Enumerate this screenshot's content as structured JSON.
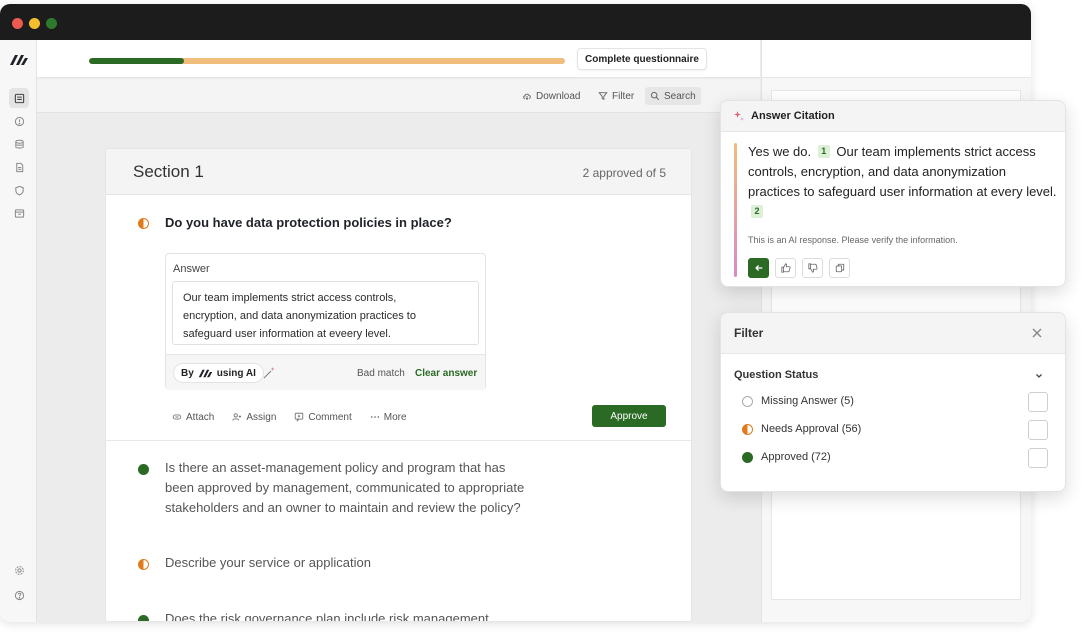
{
  "progress": {
    "approved_fraction": 0.2
  },
  "topbar": {
    "complete_label": "Complete questionnaire"
  },
  "toolbar": {
    "download_label": "Download",
    "filter_label": "Filter",
    "search_label": "Search"
  },
  "section": {
    "title": "Section 1",
    "approved_count": "2 approved of 5",
    "questions": [
      {
        "text": "Do you have data protection policies in place?",
        "status": "needs-approval"
      },
      {
        "line1": "Is there an asset-management policy and program that has",
        "line2": "been approved by management, communicated to appropriate",
        "line3": "stakeholders and an owner to maintain and review the policy?",
        "status": "approved"
      },
      {
        "text": "Describe your service or application",
        "status": "needs-approval"
      },
      {
        "text": "Does the risk governance plan include risk management",
        "status": "approved"
      }
    ]
  },
  "answer": {
    "label": "Answer",
    "line1": "Our team implements strict access controls,",
    "line2": "encryption, and data anonymization practices to",
    "line3": "safeguard user information at eveery level.",
    "by_prefix": "By",
    "by_suffix": "using AI",
    "bad_match_label": "Bad match",
    "clear_label": "Clear answer"
  },
  "actions": {
    "attach": "Attach",
    "assign": "Assign",
    "comment": "Comment",
    "more": "More",
    "approve": "Approve"
  },
  "citation": {
    "title": "Answer Citation",
    "part1": "Yes we do.",
    "num1": "1",
    "part2": "Our team implements strict access controls, encryption, and data anonymization practices to safeguard user information at every level.",
    "num2": "2",
    "note": "This is an AI response. Please verify the information."
  },
  "filter": {
    "title": "Filter",
    "section_label": "Question Status",
    "options": [
      {
        "label": "Missing Answer (5)"
      },
      {
        "label": "Needs Approval (56)"
      },
      {
        "label": "Approved (72)"
      }
    ]
  },
  "colors": {
    "brand_green": "#2a6a25",
    "pending_orange": "#e07b1c",
    "progress_remaining": "#f0bd7c"
  }
}
